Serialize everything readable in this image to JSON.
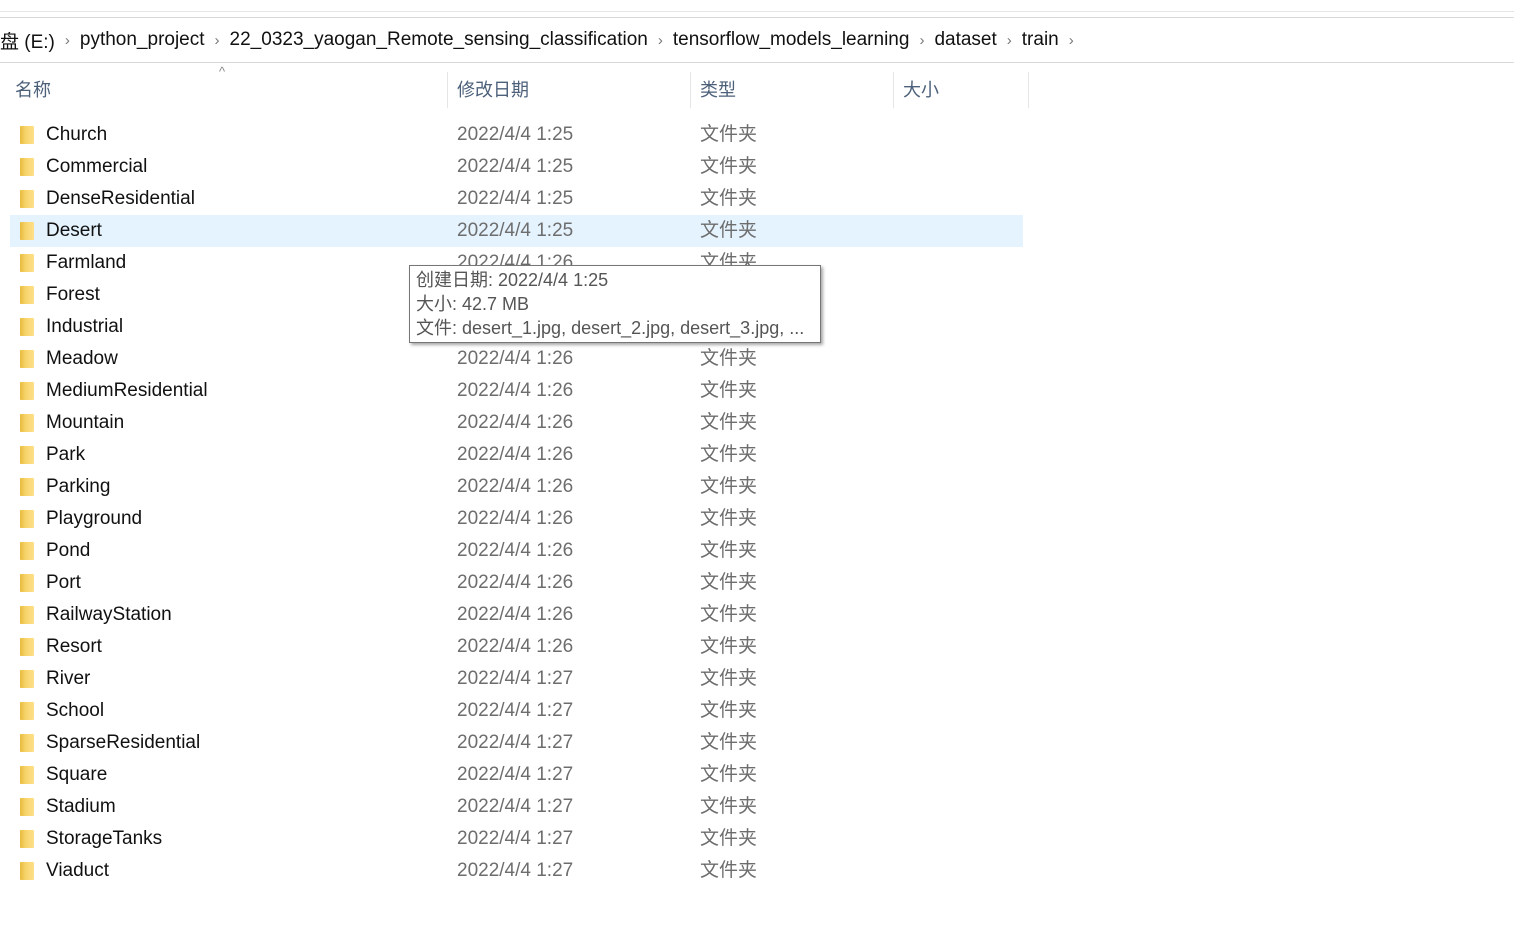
{
  "breadcrumb": [
    "盘 (E:)",
    "python_project",
    "22_0323_yaogan_Remote_sensing_classification",
    "tensorflow_models_learning",
    "dataset",
    "train"
  ],
  "columns": {
    "name": "名称",
    "date": "修改日期",
    "type": "类型",
    "size": "大小"
  },
  "selected_row": 3,
  "rows": [
    {
      "name": "Church",
      "date": "2022/4/4 1:25",
      "type": "文件夹"
    },
    {
      "name": "Commercial",
      "date": "2022/4/4 1:25",
      "type": "文件夹"
    },
    {
      "name": "DenseResidential",
      "date": "2022/4/4 1:25",
      "type": "文件夹"
    },
    {
      "name": "Desert",
      "date": "2022/4/4 1:25",
      "type": "文件夹"
    },
    {
      "name": "Farmland",
      "date": "2022/4/4 1:26",
      "type": "文件夹"
    },
    {
      "name": "Forest",
      "date": "",
      "type": ""
    },
    {
      "name": "Industrial",
      "date": "",
      "type": ""
    },
    {
      "name": "Meadow",
      "date": "2022/4/4 1:26",
      "type": "文件夹"
    },
    {
      "name": "MediumResidential",
      "date": "2022/4/4 1:26",
      "type": "文件夹"
    },
    {
      "name": "Mountain",
      "date": "2022/4/4 1:26",
      "type": "文件夹"
    },
    {
      "name": "Park",
      "date": "2022/4/4 1:26",
      "type": "文件夹"
    },
    {
      "name": "Parking",
      "date": "2022/4/4 1:26",
      "type": "文件夹"
    },
    {
      "name": "Playground",
      "date": "2022/4/4 1:26",
      "type": "文件夹"
    },
    {
      "name": "Pond",
      "date": "2022/4/4 1:26",
      "type": "文件夹"
    },
    {
      "name": "Port",
      "date": "2022/4/4 1:26",
      "type": "文件夹"
    },
    {
      "name": "RailwayStation",
      "date": "2022/4/4 1:26",
      "type": "文件夹"
    },
    {
      "name": "Resort",
      "date": "2022/4/4 1:26",
      "type": "文件夹"
    },
    {
      "name": "River",
      "date": "2022/4/4 1:27",
      "type": "文件夹"
    },
    {
      "name": "School",
      "date": "2022/4/4 1:27",
      "type": "文件夹"
    },
    {
      "name": "SparseResidential",
      "date": "2022/4/4 1:27",
      "type": "文件夹"
    },
    {
      "name": "Square",
      "date": "2022/4/4 1:27",
      "type": "文件夹"
    },
    {
      "name": "Stadium",
      "date": "2022/4/4 1:27",
      "type": "文件夹"
    },
    {
      "name": "StorageTanks",
      "date": "2022/4/4 1:27",
      "type": "文件夹"
    },
    {
      "name": "Viaduct",
      "date": "2022/4/4 1:27",
      "type": "文件夹"
    }
  ],
  "tooltip": {
    "created": "创建日期: 2022/4/4 1:25",
    "size": "大小: 42.7 MB",
    "files": "文件: desert_1.jpg, desert_2.jpg, desert_3.jpg, ..."
  },
  "colors": {
    "selection": "#e5f3ff",
    "folder": "#f7d46b"
  }
}
